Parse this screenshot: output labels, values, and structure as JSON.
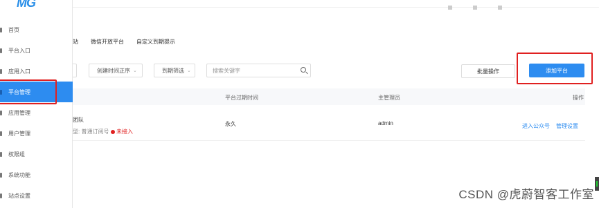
{
  "logo": "MG",
  "sidebar": {
    "items": [
      {
        "label": "首页"
      },
      {
        "label": "平台入口"
      },
      {
        "label": "应用入口"
      },
      {
        "label": "平台管理"
      },
      {
        "label": "应用管理"
      },
      {
        "label": "用户管理"
      },
      {
        "label": "权限组"
      },
      {
        "label": "系统功能"
      },
      {
        "label": "站点设置"
      }
    ],
    "active_index": 3
  },
  "tabs": [
    "站",
    "微信开放平台",
    "自定义到期提示"
  ],
  "filters": {
    "sort_label": "创建时间正序",
    "expire_label": "到期筛选",
    "search_placeholder": "搜索关键字"
  },
  "buttons": {
    "batch": "批量操作",
    "add": "添加平台"
  },
  "table": {
    "headers": [
      "平台过期时间",
      "主管理员",
      "操作"
    ],
    "rows": [
      {
        "name": "团队",
        "type": "普通订阅号",
        "status": "未接入",
        "expire": "永久",
        "admin": "admin",
        "actions": [
          "进入公众号",
          "管理设置"
        ]
      }
    ]
  },
  "watermark": "CSDN @虎蔚智客工作室",
  "colors": {
    "accent": "#2d8cf0",
    "highlight": "#e02020"
  }
}
